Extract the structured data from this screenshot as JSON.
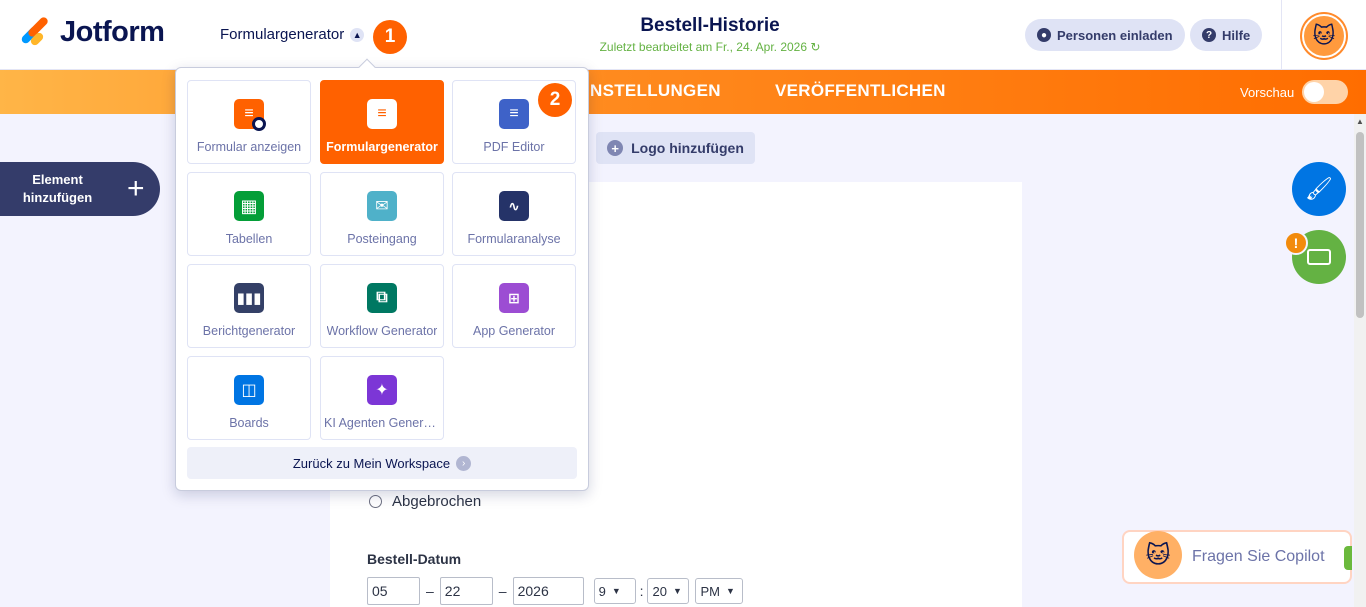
{
  "header": {
    "logo_text": "Jotform",
    "builder_switch_label": "Formulargenerator",
    "step_badge_1": "1",
    "step_badge_2": "2",
    "form_title": "Bestell-Historie",
    "last_edited": "Zuletzt bearbeitet am Fr., 24. Apr. 2026",
    "invite_label": "Personen einladen",
    "help_label": "Hilfe"
  },
  "nav": {
    "items": [
      "NSTELLUNGEN",
      "VERÖFFENTLICHEN"
    ],
    "preview_label": "Vorschau",
    "preview_on": false
  },
  "builder": {
    "add_element_label": "Element hinzufügen",
    "add_logo_label": "Logo hinzufügen"
  },
  "form": {
    "radio_option": "Abgebrochen",
    "date_field_label": "Bestell-Datum",
    "date_month": "05",
    "date_day": "22",
    "date_year": "2026",
    "date_separator": "–",
    "time_hour": "9",
    "time_minute": "20",
    "time_separator": ":",
    "time_ampm": "PM"
  },
  "app_menu": {
    "tiles": [
      {
        "label": "Formular anzeigen",
        "icon": "form-view-icon",
        "color": "#ff6100"
      },
      {
        "label": "Formulargenerator",
        "icon": "form-builder-icon",
        "color": "#ff6100",
        "active": true
      },
      {
        "label": "PDF Editor",
        "icon": "pdf-editor-icon",
        "color": "#3e62c8"
      },
      {
        "label": "Tabellen",
        "icon": "tables-icon",
        "color": "#049e38"
      },
      {
        "label": "Posteingang",
        "icon": "inbox-icon",
        "color": "#4fb1c9"
      },
      {
        "label": "Formularanalyse",
        "icon": "analytics-icon",
        "color": "#253368"
      },
      {
        "label": "Berichtgenerator",
        "icon": "report-builder-icon",
        "color": "#344067"
      },
      {
        "label": "Workflow Generator",
        "icon": "workflow-icon",
        "color": "#007862"
      },
      {
        "label": "App Generator",
        "icon": "app-builder-icon",
        "color": "#9c4dd3"
      },
      {
        "label": "Boards",
        "icon": "boards-icon",
        "color": "#0075e3"
      },
      {
        "label": "KI Agenten Generator",
        "icon": "ai-agent-icon",
        "color": "#7c36d6"
      }
    ],
    "workspace_label": "Zurück zu Mein Workspace"
  },
  "copilot": {
    "label": "Fragen Sie Copilot"
  },
  "colors": {
    "brand_orange": "#ff6100",
    "navy": "#0a1551",
    "success_green": "#64b243"
  }
}
